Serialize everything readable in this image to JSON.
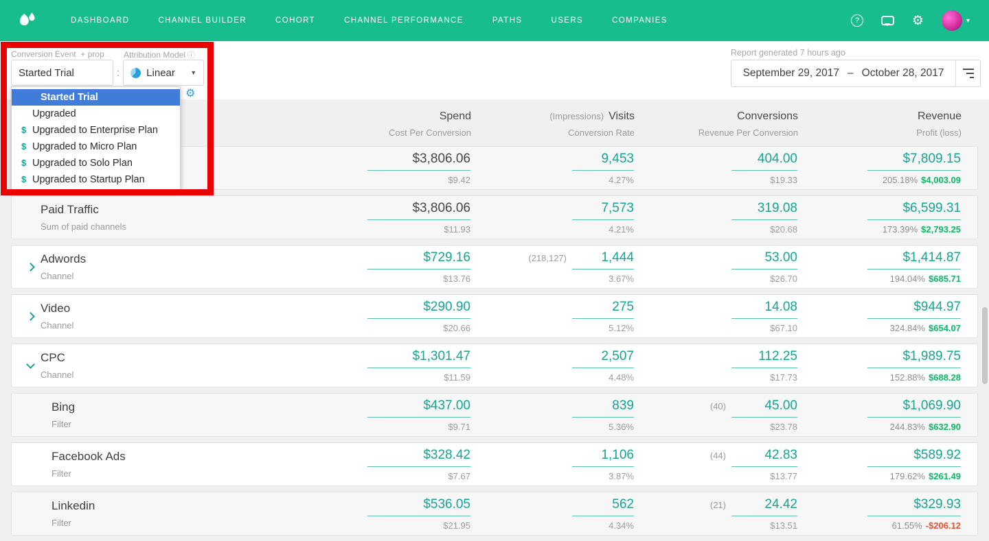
{
  "nav": {
    "items": [
      "DASHBOARD",
      "CHANNEL BUILDER",
      "COHORT",
      "CHANNEL PERFORMANCE",
      "PATHS",
      "USERS",
      "COMPANIES"
    ],
    "help_label": "?"
  },
  "filters": {
    "conversion_event_label": "Conversion Event",
    "prop_label": "+ prop",
    "attribution_model_label": "Attribution Model",
    "info_icon": "ⓘ",
    "event_value": "Started Trial",
    "separator": ":",
    "model_value": "Linear",
    "dropdown_items": [
      {
        "label": "Started Trial",
        "selected": true,
        "dollar": false
      },
      {
        "label": "Upgraded",
        "selected": false,
        "dollar": false
      },
      {
        "label": "Upgraded to Enterprise Plan",
        "selected": false,
        "dollar": true
      },
      {
        "label": "Upgraded to Micro Plan",
        "selected": false,
        "dollar": true
      },
      {
        "label": "Upgraded to Solo Plan",
        "selected": false,
        "dollar": true
      },
      {
        "label": "Upgraded to Startup Plan",
        "selected": false,
        "dollar": true
      }
    ]
  },
  "report": {
    "generated": "Report generated 7 hours ago",
    "date_start": "September 29, 2017",
    "date_separator": "–",
    "date_end": "October 28, 2017"
  },
  "table": {
    "header": {
      "spend": "Spend",
      "spend_sub": "Cost Per Conversion",
      "impressions": "(Impressions)",
      "visits": "Visits",
      "visits_sub": "Conversion Rate",
      "conversions": "Conversions",
      "conversions_sub": "Revenue Per Conversion",
      "revenue": "Revenue",
      "revenue_sub": "Profit (loss)"
    },
    "rows": [
      {
        "name": "",
        "subtitle": "",
        "chevron": null,
        "indent": false,
        "shaded": true,
        "spend": {
          "value": "$3,806.06",
          "sub": "$9.42",
          "dark": true
        },
        "visits": {
          "prefix": "",
          "value": "9,453",
          "sub": "4.27%"
        },
        "conversions": {
          "prefix": "",
          "value": "404.00",
          "sub": "$19.33"
        },
        "revenue": {
          "value": "$7,809.15",
          "pct": "205.18%",
          "profit": "$4,003.09",
          "negative": false
        }
      },
      {
        "name": "Paid Traffic",
        "subtitle": "Sum of paid channels",
        "chevron": null,
        "indent": false,
        "shaded": true,
        "spend": {
          "value": "$3,806.06",
          "sub": "$11.93",
          "dark": true
        },
        "visits": {
          "prefix": "",
          "value": "7,573",
          "sub": "4.21%"
        },
        "conversions": {
          "prefix": "",
          "value": "319.08",
          "sub": "$20.68"
        },
        "revenue": {
          "value": "$6,599.31",
          "pct": "173.39%",
          "profit": "$2,793.25",
          "negative": false
        }
      },
      {
        "name": "Adwords",
        "subtitle": "Channel",
        "chevron": "right",
        "indent": false,
        "shaded": false,
        "spend": {
          "value": "$729.16",
          "sub": "$13.76",
          "dark": false
        },
        "visits": {
          "prefix": "(218,127)",
          "value": "1,444",
          "sub": "3.67%"
        },
        "conversions": {
          "prefix": "",
          "value": "53.00",
          "sub": "$26.70"
        },
        "revenue": {
          "value": "$1,414.87",
          "pct": "194.04%",
          "profit": "$685.71",
          "negative": false
        }
      },
      {
        "name": "Video",
        "subtitle": "Channel",
        "chevron": "right",
        "indent": false,
        "shaded": false,
        "spend": {
          "value": "$290.90",
          "sub": "$20.66",
          "dark": false
        },
        "visits": {
          "prefix": "",
          "value": "275",
          "sub": "5.12%"
        },
        "conversions": {
          "prefix": "",
          "value": "14.08",
          "sub": "$67.10"
        },
        "revenue": {
          "value": "$944.97",
          "pct": "324.84%",
          "profit": "$654.07",
          "negative": false
        }
      },
      {
        "name": "CPC",
        "subtitle": "Channel",
        "chevron": "down",
        "indent": false,
        "shaded": false,
        "spend": {
          "value": "$1,301.47",
          "sub": "$11.59",
          "dark": false
        },
        "visits": {
          "prefix": "",
          "value": "2,507",
          "sub": "4.48%"
        },
        "conversions": {
          "prefix": "",
          "value": "112.25",
          "sub": "$17.73"
        },
        "revenue": {
          "value": "$1,989.75",
          "pct": "152.88%",
          "profit": "$688.28",
          "negative": false
        }
      },
      {
        "name": "Bing",
        "subtitle": "Filter",
        "chevron": null,
        "indent": true,
        "shaded": true,
        "spend": {
          "value": "$437.00",
          "sub": "$9.71",
          "dark": false
        },
        "visits": {
          "prefix": "",
          "value": "839",
          "sub": "5.36%"
        },
        "conversions": {
          "prefix": "(40)",
          "value": "45.00",
          "sub": "$23.78"
        },
        "revenue": {
          "value": "$1,069.90",
          "pct": "244.83%",
          "profit": "$632.90",
          "negative": false
        }
      },
      {
        "name": "Facebook Ads",
        "subtitle": "Filter",
        "chevron": null,
        "indent": true,
        "shaded": false,
        "spend": {
          "value": "$328.42",
          "sub": "$7.67",
          "dark": false
        },
        "visits": {
          "prefix": "",
          "value": "1,106",
          "sub": "3.87%"
        },
        "conversions": {
          "prefix": "(44)",
          "value": "42.83",
          "sub": "$13.77"
        },
        "revenue": {
          "value": "$589.92",
          "pct": "179.62%",
          "profit": "$261.49",
          "negative": false
        }
      },
      {
        "name": "Linkedin",
        "subtitle": "Filter",
        "chevron": null,
        "indent": true,
        "shaded": true,
        "spend": {
          "value": "$536.05",
          "sub": "$21.95",
          "dark": false
        },
        "visits": {
          "prefix": "",
          "value": "562",
          "sub": "4.34%"
        },
        "conversions": {
          "prefix": "(21)",
          "value": "24.42",
          "sub": "$13.51"
        },
        "revenue": {
          "value": "$329.93",
          "pct": "61.55%",
          "profit": "-$206.12",
          "negative": true
        }
      }
    ]
  },
  "colors": {
    "nav_green": "#17bd8d",
    "accent_teal": "#16a593",
    "selection_blue": "#3e7ed9",
    "profit_green": "#0cb869",
    "loss_red": "#e8512d"
  }
}
